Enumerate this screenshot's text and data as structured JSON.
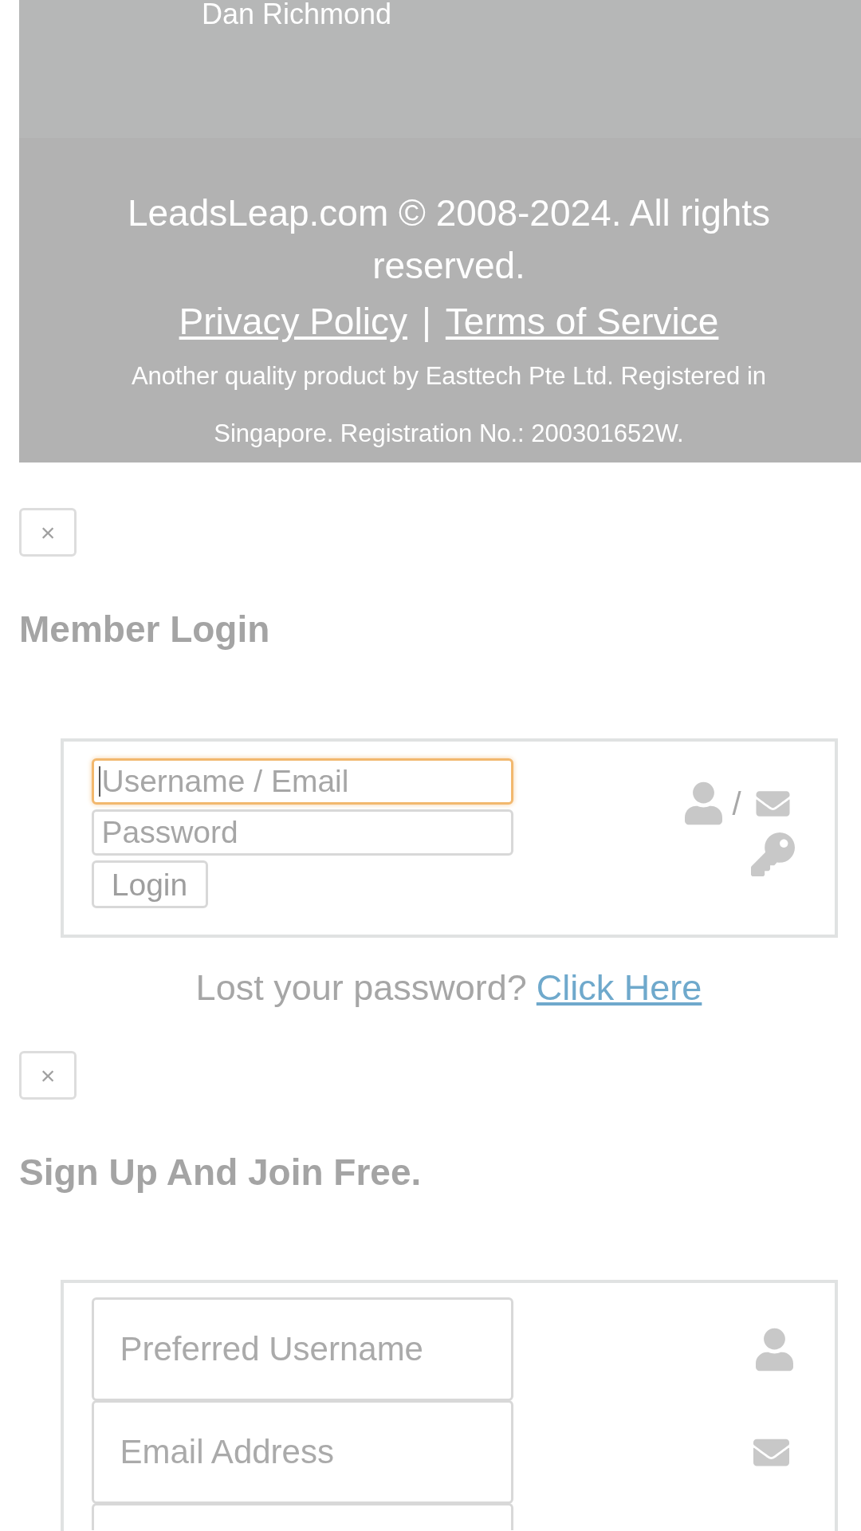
{
  "profile_panel": {
    "name": "Dan Richmond"
  },
  "footer": {
    "copyright": "LeadsLeap.com © 2008-2024. All rights reserved.",
    "links": [
      {
        "label": "Privacy Policy"
      },
      {
        "label": "Terms of Service"
      }
    ],
    "separator": "|",
    "company_note": "Another quality product by Easttech Pte Ltd. Registered in Singapore. Registration No.: 200301652W."
  },
  "login_dialog": {
    "close": "×",
    "title": "Member Login",
    "fields": [
      {
        "kind": "username",
        "placeholder": "Username / Email",
        "focused": true
      },
      {
        "kind": "password",
        "placeholder": "Password",
        "focused": false
      }
    ],
    "button": "Login",
    "icon_separator": "/",
    "lost_password": {
      "text": "Lost your password?",
      "link": "Click Here"
    }
  },
  "signup_dialog": {
    "close": "×",
    "title": "Sign Up And Join Free.",
    "fields": [
      {
        "kind": "username",
        "placeholder": "Preferred Username"
      },
      {
        "kind": "email",
        "placeholder": "Email Address"
      },
      {
        "kind": "blank"
      }
    ]
  }
}
